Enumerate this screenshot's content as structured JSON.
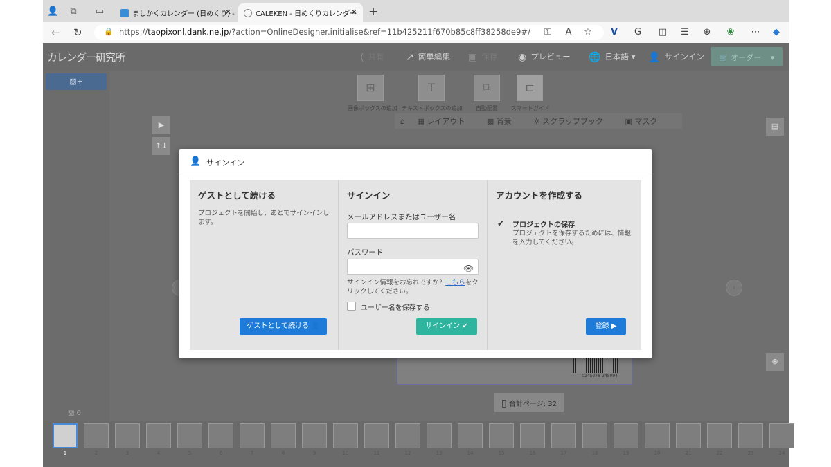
{
  "browser": {
    "tabs": [
      {
        "title": "ましかくカレンダー (日めくり) -",
        "active": false
      },
      {
        "title": "CALEKEN - 日めくりカレンダー",
        "active": true
      }
    ],
    "url_prefix": "https://",
    "url_host": "taopixonl.dank.ne.jp",
    "url_rest": "/?action=OnlineDesigner.initialise&ref=11b425211f670b85c8ff38258de9#/"
  },
  "app": {
    "logo": "カレンダー研究所",
    "header": {
      "share": "共有",
      "simple_edit": "簡単編集",
      "save": "保存",
      "preview": "プレビュー",
      "language": "日本語",
      "signin": "サインイン",
      "order": "オーダー"
    },
    "tools": [
      {
        "icon": "add-image-icon",
        "label": "画像ボックスの追加"
      },
      {
        "icon": "add-text-icon",
        "label": "テキストボックスの追加"
      },
      {
        "icon": "auto-layout-icon",
        "label": "自動配置"
      },
      {
        "icon": "smart-guide-icon",
        "label": "スマートガイド"
      }
    ],
    "subtabs": {
      "layout": "レイアウト",
      "background": "背景",
      "scrapbook": "スクラップブック",
      "mask": "マスク"
    },
    "photo_count": "0",
    "total_pages_label": "合計ページ:",
    "total_pages": "32",
    "barcode_number": "0245078-245094",
    "thumbnail_numbers": [
      "1",
      "2",
      "3",
      "4",
      "5",
      "6",
      "7",
      "8",
      "9",
      "10",
      "11",
      "12",
      "13",
      "14",
      "15",
      "16",
      "17",
      "18",
      "19",
      "20",
      "21",
      "22",
      "23",
      "24"
    ]
  },
  "modal": {
    "title": "サインイン",
    "guest": {
      "heading": "ゲストとして続ける",
      "description": "プロジェクトを開始し、あとでサインインします。",
      "button": "ゲストとして続ける"
    },
    "signin": {
      "heading": "サインイン",
      "username_label": "メールアドレスまたはユーザー名",
      "username_value": "",
      "password_label": "パスワード",
      "password_value": "",
      "forgot_prefix": "サインイン情報をお忘れですか？",
      "forgot_link": "こちら",
      "forgot_suffix": "をクリックしてください。",
      "remember_label": "ユーザー名を保存する",
      "button": "サインイン"
    },
    "create": {
      "heading": "アカウントを作成する",
      "feature_title": "プロジェクトの保存",
      "feature_desc": "プロジェクトを保存するためには、情報を入力してください。",
      "button": "登録"
    }
  }
}
